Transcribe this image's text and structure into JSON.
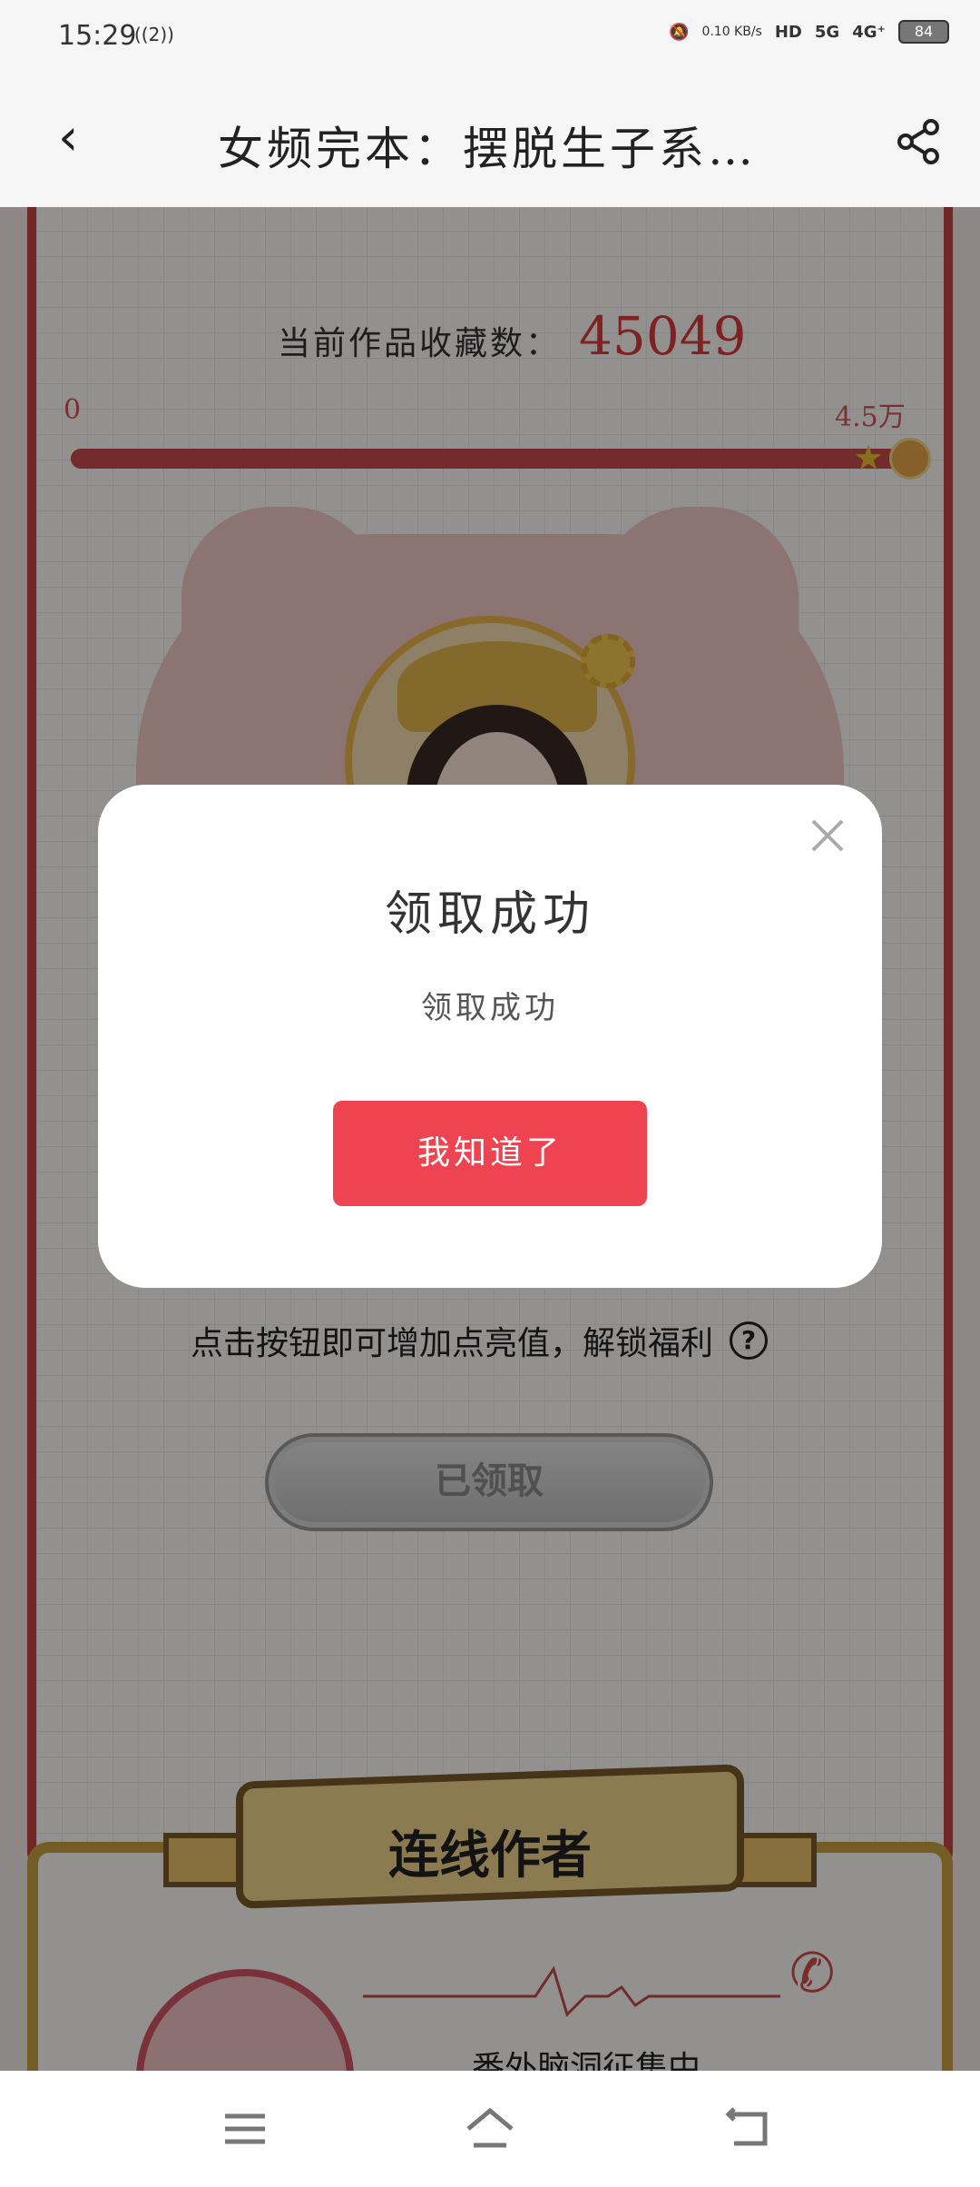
{
  "status_bar": {
    "time": "15:29",
    "signal_note": "((2))",
    "net_speed": "0.10 KB/s",
    "hd": "HD",
    "net_5g": "5G",
    "net_4g": "4G⁺",
    "battery": "84"
  },
  "nav": {
    "title": "女频完本：摆脱生子系…"
  },
  "progress": {
    "count_label": "当前作品收藏数：",
    "count_value": "45049",
    "scale_min": "0",
    "scale_max": "4.5万",
    "fraction": 1.0
  },
  "hint": {
    "text": "点击按钮即可增加点亮值，解锁福利",
    "help_glyph": "?"
  },
  "claimed_button": {
    "label": "已领取"
  },
  "section2": {
    "title": "连线作者",
    "text": "番外脑洞征集中，"
  },
  "modal": {
    "title": "领取成功",
    "message": "领取成功",
    "button_label": "我知道了"
  },
  "colors": {
    "accent_red": "#ee4350",
    "panel_border": "#c44444",
    "gold_border": "#c9a040"
  },
  "icons": {
    "back": "chevron-left-icon",
    "share": "share-icon",
    "close": "close-icon",
    "help": "question-circle-icon",
    "menu": "menu-icon",
    "home": "home-icon",
    "return": "back-arrow-icon",
    "phone": "phone-icon"
  }
}
